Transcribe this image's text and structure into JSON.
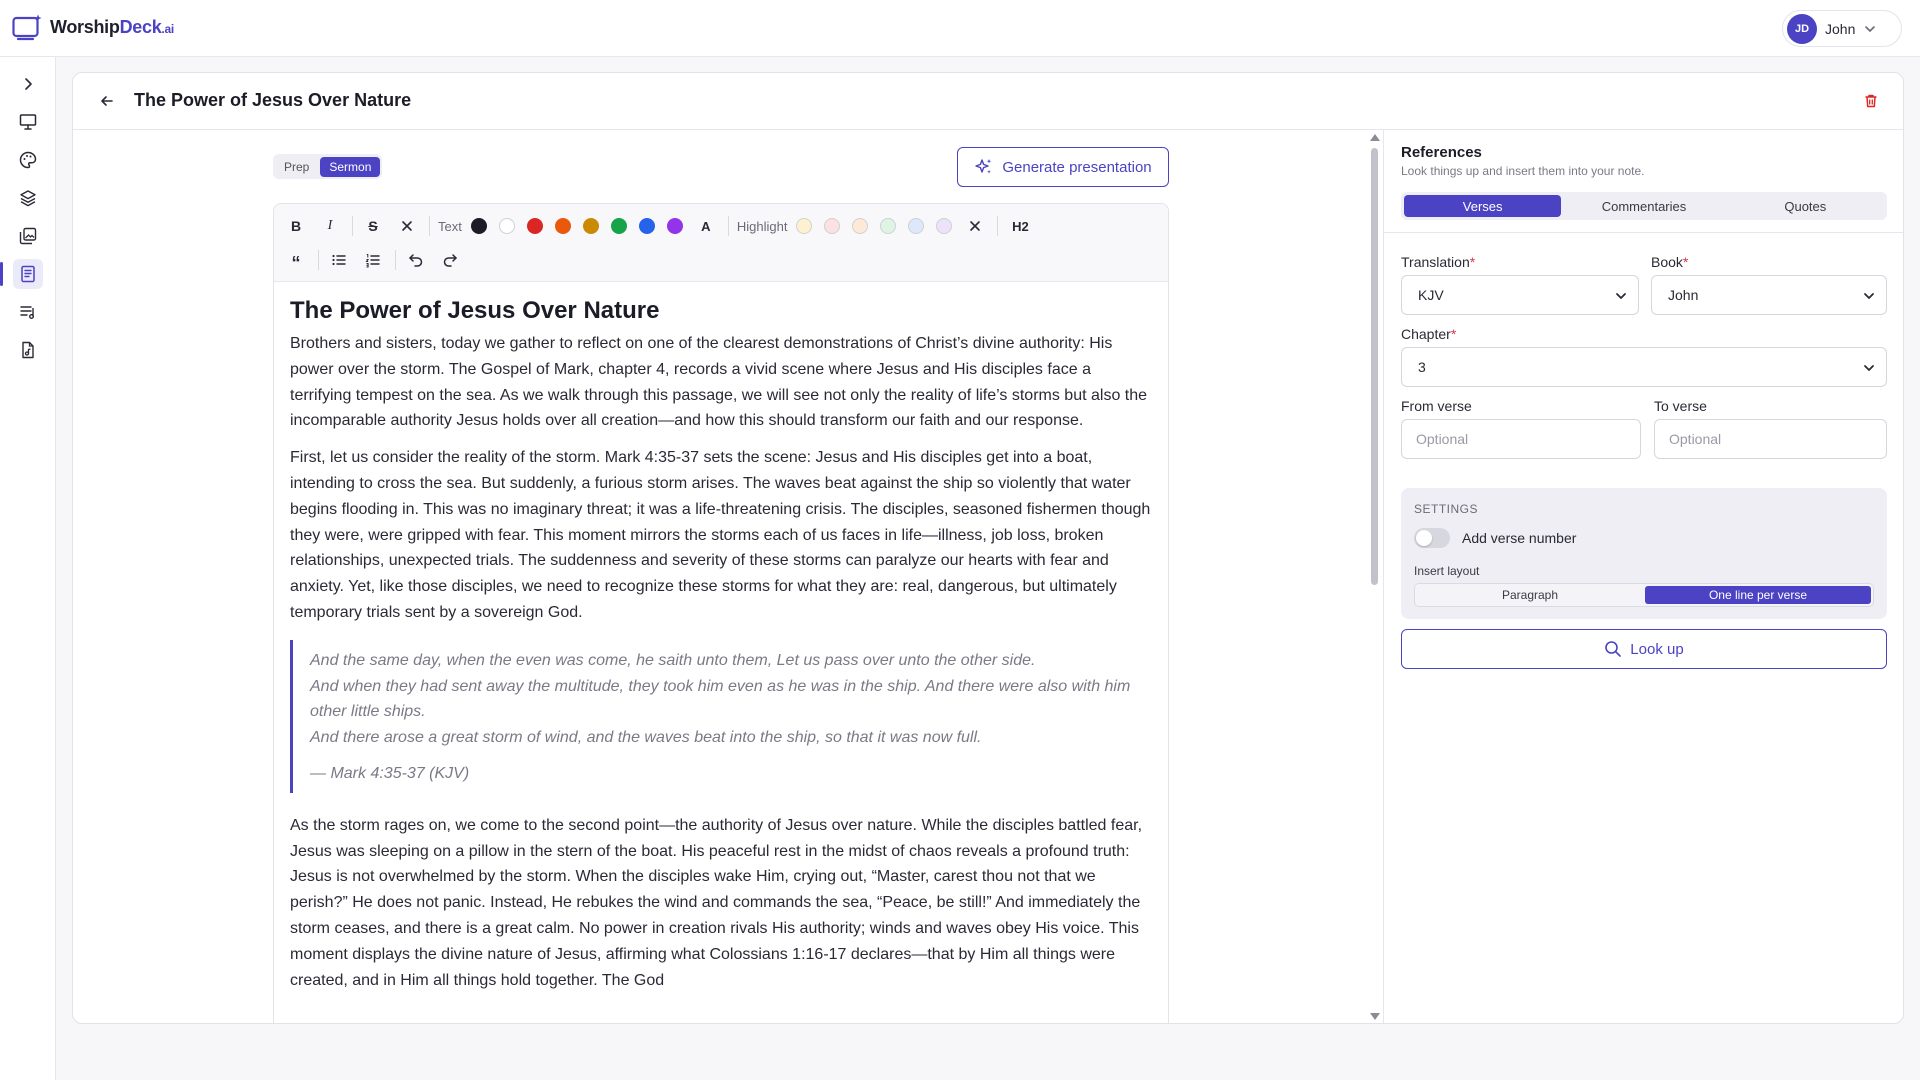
{
  "app": {
    "logo_name": "Worship",
    "logo_deck": "Deck",
    "logo_suffix": ".ai"
  },
  "user": {
    "initials": "JD",
    "name": "John"
  },
  "note": {
    "title": "The Power of Jesus Over Nature"
  },
  "mode": {
    "prep_label": "Prep",
    "sermon_label": "Sermon",
    "active": "Sermon"
  },
  "actions": {
    "generate_label": "Generate presentation"
  },
  "toolbar": {
    "bold": "B",
    "italic": "I",
    "strike": "S",
    "text_label": "Text",
    "text_colors": [
      "#1c1c28",
      "#ffffff",
      "#dc2626",
      "#ea580c",
      "#ca8a04",
      "#16a34a",
      "#2563eb",
      "#9333ea"
    ],
    "font_a": "A",
    "highlight_label": "Highlight",
    "highlight_colors": [
      "#fdf1cf",
      "#fbe1e1",
      "#fde9d6",
      "#def5e4",
      "#dde8fb",
      "#ece3fb"
    ],
    "h2": "H2",
    "quote": "“"
  },
  "document": {
    "heading": "The Power of Jesus Over Nature",
    "paragraph1": "Brothers and sisters, today we gather to reflect on one of the clearest demonstrations of Christ’s divine authority: His power over the storm. The Gospel of Mark, chapter 4, records a vivid scene where Jesus and His disciples face a terrifying tempest on the sea. As we walk through this passage, we will see not only the reality of life’s storms but also the incomparable authority Jesus holds over all creation—and how this should transform our faith and our response.",
    "paragraph2": "First, let us consider the reality of the storm. Mark 4:35-37 sets the scene: Jesus and His disciples get into a boat, intending to cross the sea. But suddenly, a furious storm arises. The waves beat against the ship so violently that water begins flooding in. This was no imaginary threat; it was a life-threatening crisis. The disciples, seasoned fishermen though they were, were gripped with fear. This moment mirrors the storms each of us faces in life—illness, job loss, broken relationships, unexpected trials. The suddenness and severity of these storms can paralyze our hearts with fear and anxiety. Yet, like those disciples, we need to recognize these storms for what they are: real, dangerous, but ultimately temporary trials sent by a sovereign God.",
    "quote_line1": "And the same day, when the even was come, he saith unto them, Let us pass over unto the other side.",
    "quote_line2": "And when they had sent away the multitude, they took him even as he was in the ship. And there were also with him other little ships.",
    "quote_line3": "And there arose a great storm of wind, and the waves beat into the ship, so that it was now full.",
    "quote_ref": "— Mark 4:35-37 (KJV)",
    "paragraph3": "As the storm rages on, we come to the second point—the authority of Jesus over nature. While the disciples battled fear, Jesus was sleeping on a pillow in the stern of the boat. His peaceful rest in the midst of chaos reveals a profound truth: Jesus is not overwhelmed by the storm. When the disciples wake Him, crying out, “Master, carest thou not that we perish?” He does not panic. Instead, He rebukes the wind and commands the sea, “Peace, be still!” And immediately the storm ceases, and there is a great calm. No power in creation rivals His authority; winds and waves obey His voice. This moment displays the divine nature of Jesus, affirming what Colossians 1:16-17 declares—that by Him all things were created, and in Him all things hold together. The God"
  },
  "references": {
    "title": "References",
    "subtitle": "Look things up and insert them into your note.",
    "tabs": [
      "Verses",
      "Commentaries",
      "Quotes"
    ],
    "active_tab": "Verses",
    "translation_label": "Translation",
    "translation_value": "KJV",
    "book_label": "Book",
    "book_value": "John",
    "chapter_label": "Chapter",
    "chapter_value": "3",
    "from_label": "From verse",
    "from_placeholder": "Optional",
    "to_label": "To verse",
    "to_placeholder": "Optional",
    "required_mark": "*",
    "settings_title": "SETTINGS",
    "verse_number_label": "Add verse number",
    "verse_number_on": false,
    "layout_label": "Insert layout",
    "layout_options": [
      "Paragraph",
      "One line per verse"
    ],
    "layout_active": "One line per verse",
    "lookup_label": "Look up"
  },
  "colors": {
    "accent": "#4b43c4",
    "danger": "#dc2626"
  },
  "icons": [
    "logo-icon",
    "chevron-down-icon",
    "chevron-right-icon",
    "presentation-icon",
    "palette-icon",
    "layers-icon",
    "gallery-icon",
    "notes-icon",
    "setlist-icon",
    "song-file-icon",
    "back-arrow-icon",
    "trash-icon",
    "sparkles-icon",
    "clear-format-icon",
    "bullet-list-icon",
    "numbered-list-icon",
    "undo-icon",
    "redo-icon",
    "search-icon"
  ]
}
